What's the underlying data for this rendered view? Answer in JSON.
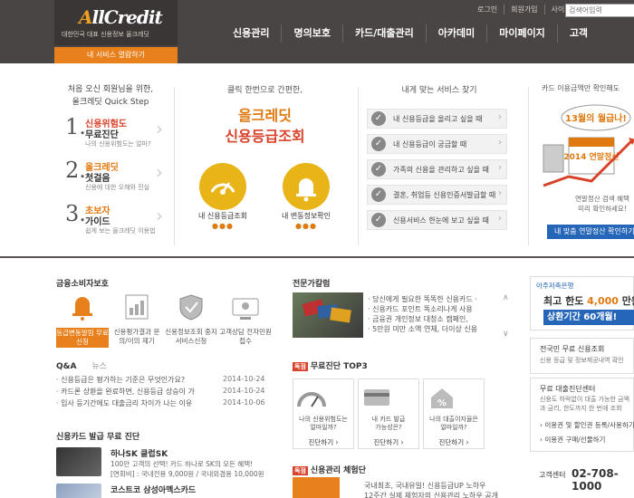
{
  "header": {
    "logo": "AllCredit",
    "logo_tagline": "대한민국 대표 신용정보 올크레딧",
    "service_button": "내 서비스 열람하기",
    "top_links": [
      "로그인",
      "회원가입",
      "사이트맵"
    ],
    "search_placeholder": "검색어입력",
    "nav": [
      "신용관리",
      "명의보호",
      "카드/대출관리",
      "아카데미",
      "마이페이지",
      "고객"
    ]
  },
  "quick_step": {
    "title_line1": "처음 오신 회원님을 위한,",
    "title_line2": "올크레딧 Quick Step",
    "steps": [
      {
        "num": "1.",
        "t1": "신용위험도",
        "t2": "무료진단",
        "desc": "나의 신용위험도는 얼마?"
      },
      {
        "num": "2.",
        "t1": "올크레딧",
        "t2": "첫걸음",
        "desc": "신용에 대한 오해와 진실"
      },
      {
        "num": "3.",
        "t1": "초보자",
        "t2": "가이드",
        "desc": "쉽게 보는 올크레딧 이용법"
      }
    ]
  },
  "grade_check": {
    "subtitle": "클릭 한번으로 간편한,",
    "title1": "올크레딧",
    "title2": "신용등급조회",
    "items": [
      {
        "label": "내 신용등급조회",
        "dots": "●●●"
      },
      {
        "label": "내 변동정보확인",
        "dots": "●●●"
      }
    ]
  },
  "service_finder": {
    "title": "내게 맞는 서비스 찾기",
    "items": [
      "내 신용등급을 올리고 싶을 때",
      "내 신용등급이 궁금할 때",
      "가족의 신용을 관리하고 싶을 때",
      "결혼, 취업등 신용인증서발급할 때",
      "신용서비스 한눈에 보고 싶을 때"
    ]
  },
  "tax_promo": {
    "title": "카드 이용금액만 확인해도",
    "bubble": "13월의 월급나!",
    "calendar": "2014 연말정산",
    "note1": "연말정산 검색 혜택",
    "note2": "미리 확인하세요!",
    "button": "내 맞춤 연말정산 확인하기"
  },
  "consumer": {
    "title": "금융소비자보호",
    "items": [
      {
        "label": "등급변동알림 무료신청",
        "highlight": true
      },
      {
        "label": "신용평가결과 문의/이의 제기",
        "highlight": false
      },
      {
        "label": "신용정보조회 중지서비스신청",
        "highlight": false
      },
      {
        "label": "고객상담 전자민원접수",
        "highlight": false
      }
    ]
  },
  "expert": {
    "title": "전문가칼럼",
    "items": [
      "· 당신에게 필요한 똑똑한 신용카드 ·",
      "· 신용카드 포인트 똑소리나게 사용",
      "· 금융권 개인정보 대청소 캠페인,",
      "· 5만원 미만 소액 연체, 더이상 신용"
    ]
  },
  "qa": {
    "tab_active": "Q&A",
    "tab_other": "뉴스",
    "rows": [
      {
        "q": "· 신용등급은 평가하는 기준은 무엇인가요?",
        "d": "2014-10-24"
      },
      {
        "q": "· 카드론 상환을 완료하면, 신용등급 상승이 가",
        "d": "2014-10-24"
      },
      {
        "q": "· 입사 등기간에도 대출금리 차이가 나는 이유",
        "d": "2014-10-06"
      }
    ]
  },
  "free_top3": {
    "badge": "독점",
    "title": "무료진단 TOP3",
    "items": [
      {
        "text1": "나의 신용위험도는",
        "text2": "얼마일까?",
        "btn": "진단하기 ›"
      },
      {
        "text1": "내 카드 발급",
        "text2": "가능성은?",
        "btn": "진단하기 ›"
      },
      {
        "text1": "나의 대출이자율은",
        "text2": "얼마일까?",
        "btn": "진단하기 ›"
      }
    ]
  },
  "card_diag": {
    "title": "신용카드 발급 무료 진단",
    "items": [
      {
        "name": "하나SK 클럽SK",
        "desc": "100만 고객의 선택! 카드 하나로 SK의 모든 혜택!",
        "info": "[연회비] : 국내전용 9,000원 / 국내외겸용 10,000원"
      },
      {
        "name": "코스트코 삼성아멕스카드",
        "desc": "",
        "info": ""
      }
    ]
  },
  "credit_program": {
    "badge": "독점",
    "title": "신용관리 체험단",
    "text1": "국내최초, 국내유일! 신용등급UP 노하우",
    "text2": "12주간 실제 체험자의 신용관리 노하우 공개"
  },
  "right": {
    "bank": "아주저축은행",
    "promo1_pre": "최고 한도 ",
    "promo1_amount": "4,000",
    "promo1_post": " 만원",
    "promo2": "상환기간 60개월!",
    "box1_title": "전국민 무료 신용조회",
    "box1_sub": "신용 등급 및 정보제공내역 확인",
    "box2_title": "무료 대출진단센터",
    "box2_sub1": "신용도 하락없이 대출 가능한 금액",
    "box2_sub2": "과 금리, 한도까지 한 번에 조회",
    "links": [
      "› 이용권 및 할인권 등록/사용하기",
      "› 이용권 구매/선물하기"
    ],
    "cs_label": "고객센터",
    "cs_phone": "02-708-1000"
  }
}
